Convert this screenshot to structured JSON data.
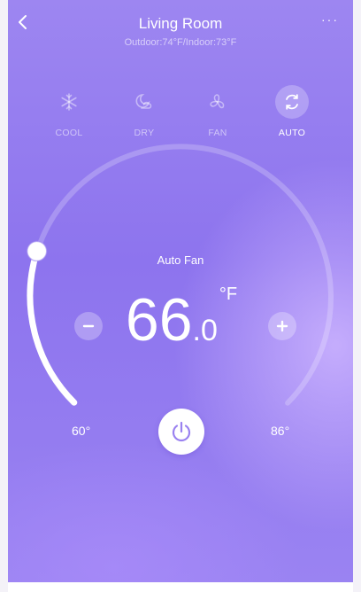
{
  "header": {
    "title": "Living Room",
    "subtitle": "Outdoor:74°F/Indoor:73°F",
    "back_icon": "chevron-left-icon",
    "more_label": "···"
  },
  "modes": [
    {
      "label": "COOL",
      "icon": "snowflake-icon",
      "active": false
    },
    {
      "label": "DRY",
      "icon": "moon-cloud-icon",
      "active": false
    },
    {
      "label": "FAN",
      "icon": "fan-icon",
      "active": false
    },
    {
      "label": "AUTO",
      "icon": "auto-cycle-icon",
      "active": true
    }
  ],
  "thermostat": {
    "fan_mode": "Auto Fan",
    "temp_int": "66",
    "temp_dec": ".0",
    "unit": "°F",
    "min_label": "60°",
    "max_label": "86°",
    "value": 66.0,
    "min": 60,
    "max": 86
  },
  "controls": {
    "decrease_icon": "minus-icon",
    "increase_icon": "plus-icon",
    "power_icon": "power-icon"
  },
  "colors": {
    "background_top": "#9d86f1",
    "background_bottom": "#9a83f2",
    "power_icon": "#9a82f0"
  }
}
